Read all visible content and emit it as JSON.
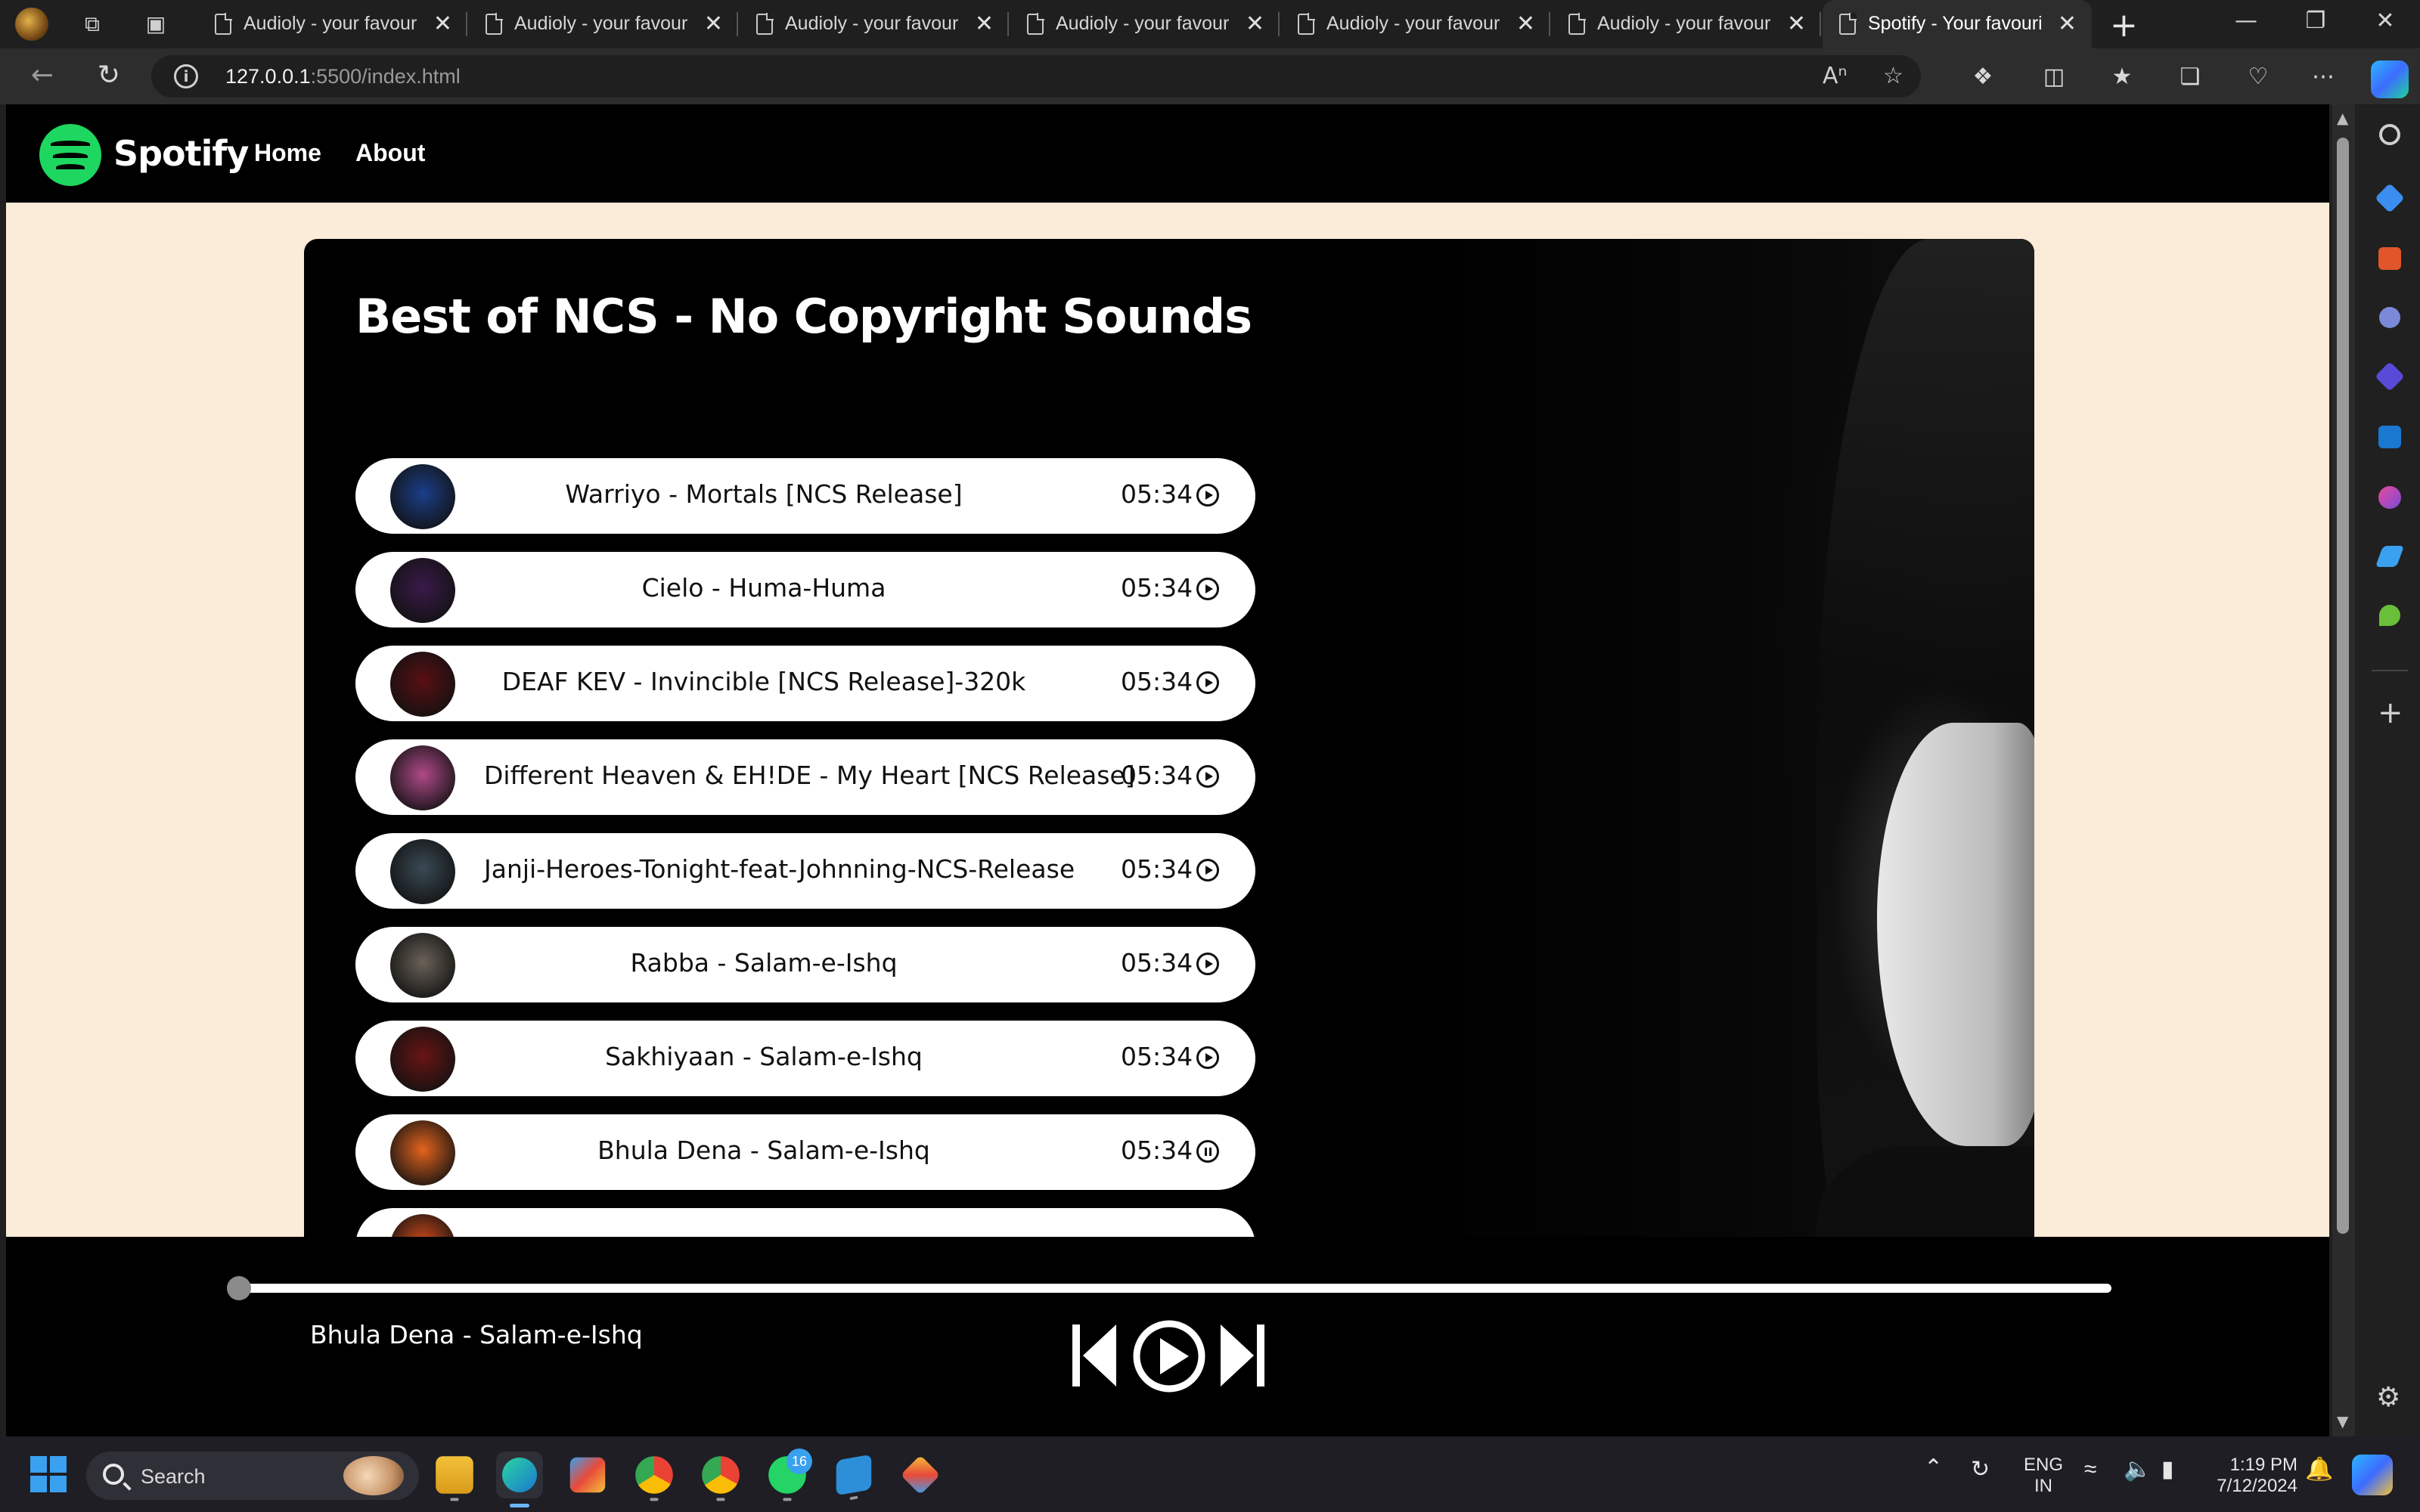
{
  "browser": {
    "tabs": [
      {
        "title": "Audioly - your favourite music",
        "active": false
      },
      {
        "title": "Audioly - your favourite music",
        "active": false
      },
      {
        "title": "Audioly - your favourite music",
        "active": false
      },
      {
        "title": "Audioly - your favourite music",
        "active": false
      },
      {
        "title": "Audioly - your favourite music",
        "active": false
      },
      {
        "title": "Audioly - your favourite music",
        "active": false
      },
      {
        "title": "Spotify - Your favourite music",
        "active": true
      }
    ],
    "url_host": "127.0.0.1",
    "url_rest": ":5500/index.html"
  },
  "site": {
    "brand": "Spotify",
    "nav": [
      "Home",
      "About"
    ],
    "playlist_title": "Best of NCS - No Copyright Sounds",
    "accent_color": "#1ed760",
    "songs": [
      {
        "name": "Warriyo - Mortals [NCS Release]",
        "duration": "05:34",
        "state": "play",
        "cover_color": "#1b3f8a"
      },
      {
        "name": "Cielo - Huma-Huma",
        "duration": "05:34",
        "state": "play",
        "cover_color": "#3a1a4a"
      },
      {
        "name": "DEAF KEV - Invincible [NCS Release]-320k",
        "duration": "05:34",
        "state": "play",
        "cover_color": "#5a0f12"
      },
      {
        "name": "Different Heaven & EH!DE - My Heart [NCS Release]",
        "duration": "05:34",
        "state": "play",
        "cover_color": "#b04a8a"
      },
      {
        "name": "Janji-Heroes-Tonight-feat-Johnning-NCS-Release",
        "duration": "05:34",
        "state": "play",
        "cover_color": "#3a4a55"
      },
      {
        "name": "Rabba - Salam-e-Ishq",
        "duration": "05:34",
        "state": "play",
        "cover_color": "#6a6258"
      },
      {
        "name": "Sakhiyaan - Salam-e-Ishq",
        "duration": "05:34",
        "state": "play",
        "cover_color": "#6a1414"
      },
      {
        "name": "Bhula Dena - Salam-e-Ishq",
        "duration": "05:34",
        "state": "pause",
        "cover_color": "#e4641e"
      },
      {
        "name": "",
        "duration": "",
        "state": "play",
        "cover_color": "#d04a1a"
      }
    ]
  },
  "player": {
    "now_playing": "Bhula Dena - Salam-e-Ishq",
    "progress": 0.0
  },
  "taskbar": {
    "search_label": "Search",
    "whatsapp_badge": "16",
    "lang_line1": "ENG",
    "lang_line2": "IN",
    "time": "1:19 PM",
    "date": "7/12/2024"
  }
}
